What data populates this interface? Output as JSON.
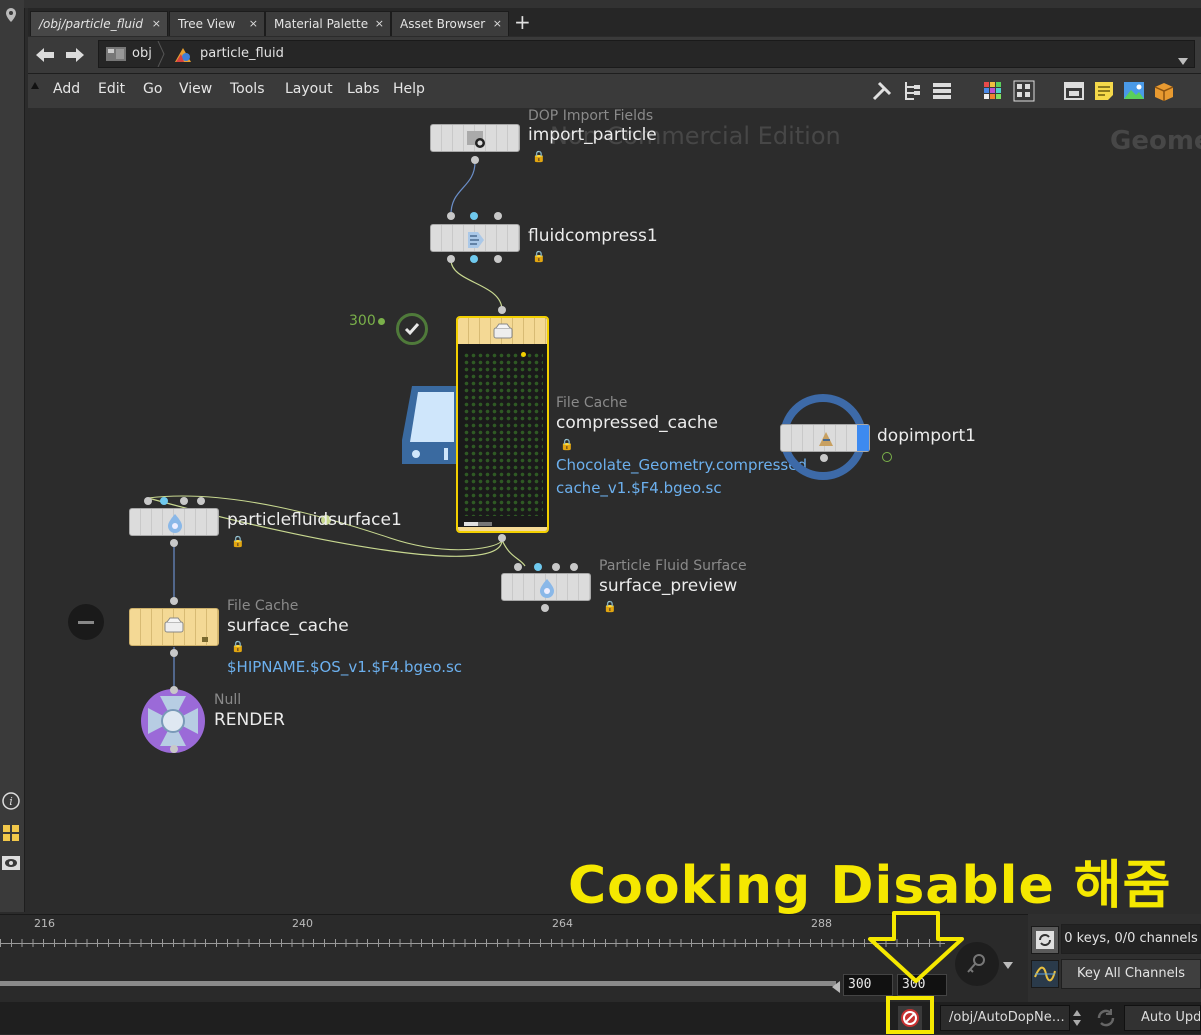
{
  "tabs": [
    {
      "label": "/obj/particle_fluid",
      "active": true
    },
    {
      "label": "Tree View",
      "active": false
    },
    {
      "label": "Material Palette",
      "active": false
    },
    {
      "label": "Asset Browser",
      "active": false
    }
  ],
  "tab_close_glyph": "×",
  "add_tab_glyph": "+",
  "path": {
    "segment1": "obj",
    "segment2": "particle_fluid"
  },
  "menu": [
    "Add",
    "Edit",
    "Go",
    "View",
    "Tools",
    "Layout",
    "Labs",
    "Help"
  ],
  "watermarks": {
    "edition": "Non-Commercial Edition",
    "context": "Geometry"
  },
  "nodes": {
    "import_particle": {
      "type": "DOP Import Fields",
      "name": "import_particle"
    },
    "fluidcompress1": {
      "name": "fluidcompress1"
    },
    "compressed_cache": {
      "type": "File Cache",
      "name": "compressed_cache",
      "path_line1": "Chocolate_Geometry.compressed_",
      "path_line2": "cache_v1.$F4.bgeo.sc",
      "frame": "300"
    },
    "dopimport1": {
      "name": "dopimport1"
    },
    "particlefluidsurface1": {
      "name": "particlefluidsurface1"
    },
    "surface_preview": {
      "type": "Particle Fluid Surface",
      "name": "surface_preview"
    },
    "surface_cache": {
      "type": "File Cache",
      "name": "surface_cache",
      "path": "$HIPNAME.$OS_v1.$F4.bgeo.sc"
    },
    "render": {
      "type": "Null",
      "name": "RENDER"
    }
  },
  "timeline": {
    "ticks": [
      "216",
      "240",
      "264",
      "288"
    ],
    "start_frame": "300",
    "end_frame": "300"
  },
  "channels": {
    "keys_text": "0 keys, 0/0 channels",
    "key_all": "Key All Channels"
  },
  "status": {
    "path": "/obj/AutoDopNetwork",
    "auto_update": "Auto Update"
  },
  "annotation": {
    "text": "Cooking Disable 해줌",
    "color": "#f5e800"
  }
}
